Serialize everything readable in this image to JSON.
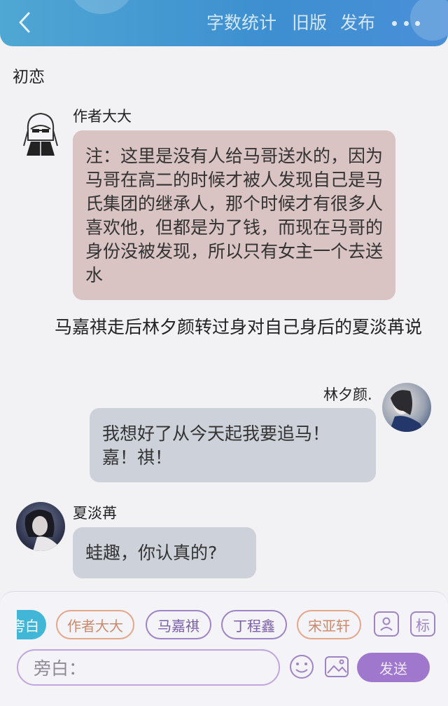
{
  "header": {
    "word_count": "字数统计",
    "old_version": "旧版",
    "publish": "发布"
  },
  "chapter_title": "初恋",
  "messages": {
    "author": {
      "name": "作者大大",
      "text": "注：这里是没有人给马哥送水的，因为马哥在高二的时候才被人发现自己是马氏集团的继承人，那个时候才有很多人喜欢他，但都是为了钱，而现在马哥的身份没被发现，所以只有女主一个去送水"
    },
    "narration": "马嘉祺走后林夕颜转过身对自己身后的夏淡苒说",
    "linxiyan": {
      "name": "林夕颜.",
      "text": "我想好了从今天起我要追马！嘉！祺！"
    },
    "xiadanran": {
      "name": "夏淡苒",
      "text": "蛙趣，你认真的?"
    }
  },
  "bottom": {
    "chips": [
      "旁白",
      "作者大大",
      "马嘉祺",
      "丁程鑫",
      "宋亚轩"
    ],
    "tag_icon_label": "标",
    "input_placeholder": "旁白：",
    "send": "发送"
  },
  "colors": {
    "header_blue": "#3d8fd0",
    "author_bubble": "#d9c3c3",
    "gray_bubble": "#cdd1d9",
    "active_chip": "#41b6d6",
    "purple": "#9f77cc"
  }
}
